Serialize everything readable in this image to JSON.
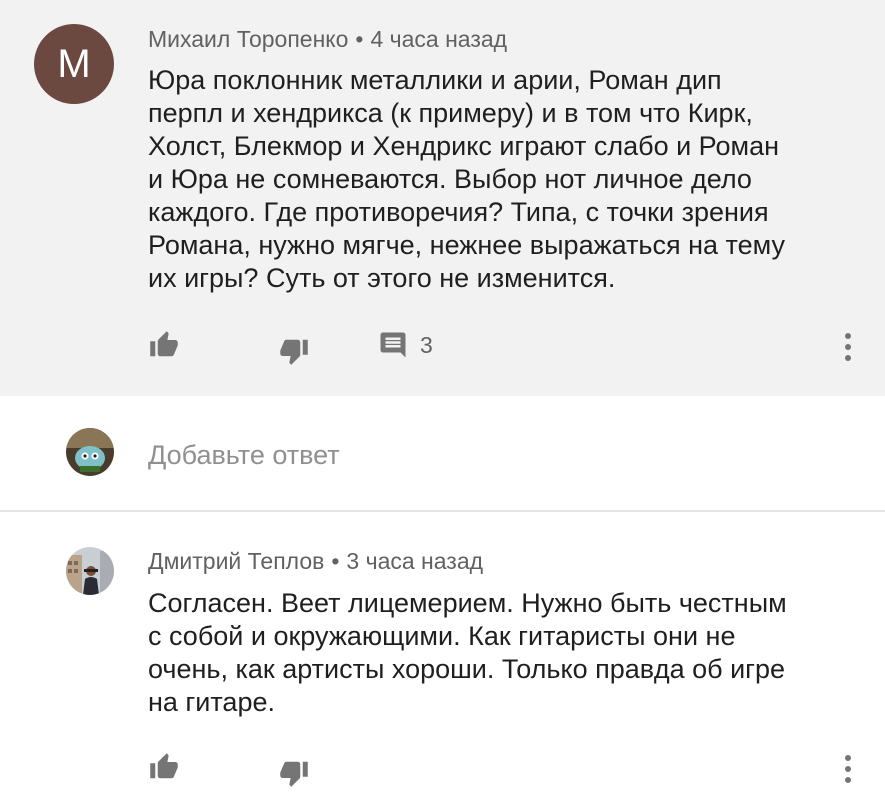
{
  "comment_main": {
    "avatar_letter": "M",
    "avatar_color": "#6b4840",
    "author": "Михаил Торопенко",
    "separator": "•",
    "time": "4 часа назад",
    "text_lines": [
      "Юра поклонник металлики и арии, Роман дип",
      "перпл и хендрикса (к примеру) и в том что Кирк,",
      "Холст, Блекмор и Хендрикс играют слабо и Роман",
      "и Юра не сомневаются. Выбор нот личное дело",
      "каждого. Где противоречия? Типа, с точки зрения",
      "Романа, нужно мягче, нежнее выражаться на тему",
      "их игры? Суть от этого не изменится."
    ],
    "reply_count": "3",
    "icons": [
      "thumb-up-icon",
      "thumb-down-icon",
      "comment-icon",
      "more-vert-icon"
    ]
  },
  "reply_box": {
    "placeholder": "Добавьте ответ"
  },
  "comment_reply": {
    "author": "Дмитрий Теплов",
    "separator": "•",
    "time": "3 часа назад",
    "text_lines": [
      "Согласен. Веет лицемерием. Нужно быть честным",
      "с собой и окружающими. Как гитаристы они не",
      "очень, как артисты хороши. Только правда об игре",
      "на гитаре."
    ],
    "icons": [
      "thumb-up-icon",
      "thumb-down-icon",
      "more-vert-icon"
    ]
  },
  "colors": {
    "highlight_background": "#f2f2f2",
    "meta_text": "#616161",
    "icon": "#757575"
  }
}
